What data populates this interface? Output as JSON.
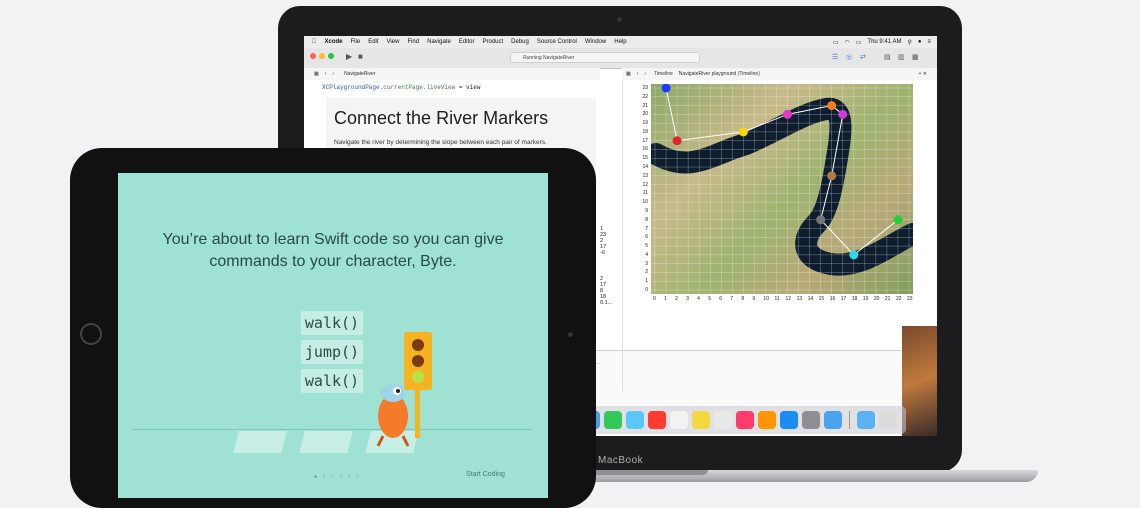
{
  "mac": {
    "device_label": "MacBook",
    "menubar": {
      "items": [
        "Xcode",
        "File",
        "Edit",
        "View",
        "Find",
        "Navigate",
        "Editor",
        "Product",
        "Debug",
        "Source Control",
        "Window",
        "Help"
      ],
      "clock": "Thu 9:41 AM"
    },
    "toolbar": {
      "status": "Running NavigateRiver"
    },
    "left_jumpbar": {
      "crumb": "NavigateRiver"
    },
    "right_jumpbar": {
      "crumb1": "Timeline",
      "crumb2": "NavigateRiver playground (Timeline)"
    },
    "code": {
      "line_prefix": "XCPlaygroundPage.",
      "line_prop1": "currentPage",
      "line_mid": ".",
      "line_prop2": "liveView",
      "line_suffix": " = view"
    },
    "prose": {
      "title": "Connect the River Markers",
      "body": "Navigate the river by determining the slope between each pair of markers."
    },
    "gutter": {
      "block1": [
        "1",
        "23",
        "2",
        "17",
        "-6"
      ],
      "block2": [
        "2",
        "17",
        "8",
        "18",
        "0.1..."
      ]
    },
    "plot": {
      "y_ticks": [
        "23",
        "22",
        "21",
        "20",
        "19",
        "18",
        "17",
        "16",
        "15",
        "14",
        "13",
        "12",
        "11",
        "10",
        "9",
        "8",
        "7",
        "6",
        "5",
        "4",
        "3",
        "2",
        "1",
        "0"
      ],
      "x_ticks": [
        "0",
        "1",
        "2",
        "3",
        "4",
        "5",
        "6",
        "7",
        "8",
        "9",
        "10",
        "11",
        "12",
        "13",
        "14",
        "15",
        "16",
        "17",
        "18",
        "19",
        "20",
        "21",
        "22",
        "23"
      ],
      "markers": [
        {
          "x": 1,
          "y": 23,
          "color": "#1a3cff"
        },
        {
          "x": 2,
          "y": 17,
          "color": "#e3262e"
        },
        {
          "x": 8,
          "y": 18,
          "color": "#f5d90a"
        },
        {
          "x": 12,
          "y": 20,
          "color": "#e337c9"
        },
        {
          "x": 16,
          "y": 21,
          "color": "#f57c1f"
        },
        {
          "x": 17,
          "y": 20,
          "color": "#c83bd6"
        },
        {
          "x": 16,
          "y": 13,
          "color": "#b07a4a"
        },
        {
          "x": 15,
          "y": 8,
          "color": "#777777"
        },
        {
          "x": 18,
          "y": 4,
          "color": "#2fd7e8"
        },
        {
          "x": 22,
          "y": 8,
          "color": "#22d13a"
        }
      ]
    }
  },
  "ipad": {
    "intro": "You’re about to learn Swift code so you can give commands to your character, Byte.",
    "commands": [
      "walk()",
      "jump()",
      "walk()"
    ],
    "page_dots": "● ○ ○ ○ ○ ○",
    "start_label": "Start Coding"
  },
  "colors": {
    "ipad_bg": "#9fe2d3",
    "river": "#0f1e2e",
    "path_line": "#ffffff"
  }
}
